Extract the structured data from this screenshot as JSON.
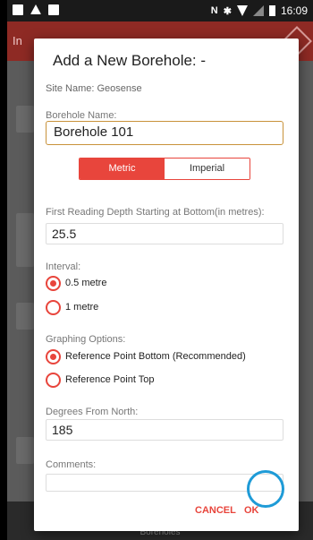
{
  "statusbar": {
    "time": "16:09",
    "nfc": "N"
  },
  "appbar": {
    "title": "In"
  },
  "bottombar": {
    "label": "Boreholes"
  },
  "dialog": {
    "title": "Add a New Borehole: -",
    "site_name": "Site Name:  Geosense",
    "borehole_name_label": "Borehole Name:",
    "borehole_name_value": "Borehole 101",
    "units": {
      "metric": "Metric",
      "imperial": "Imperial",
      "selected": "Metric"
    },
    "first_reading_label": "First Reading Depth Starting at Bottom(in metres):",
    "first_reading_value": "25.5",
    "interval_label": "Interval:",
    "interval_options": [
      "0.5 metre",
      "1 metre"
    ],
    "interval_selected": "0.5 metre",
    "graphing_label": "Graphing Options:",
    "graphing_options": [
      "Reference Point Bottom (Recommended)",
      "Reference Point Top"
    ],
    "graphing_selected": "Reference Point Bottom (Recommended)",
    "degrees_label": "Degrees From North:",
    "degrees_value": "185",
    "comments_label": "Comments:",
    "comments_value": "",
    "cancel_label": "CANCEL",
    "ok_label": "OK"
  },
  "colors": {
    "accent": "#e8453c",
    "appbar": "#8e2a24",
    "highlight_ring": "#1e9bd7",
    "input_focus": "#c8923a"
  }
}
